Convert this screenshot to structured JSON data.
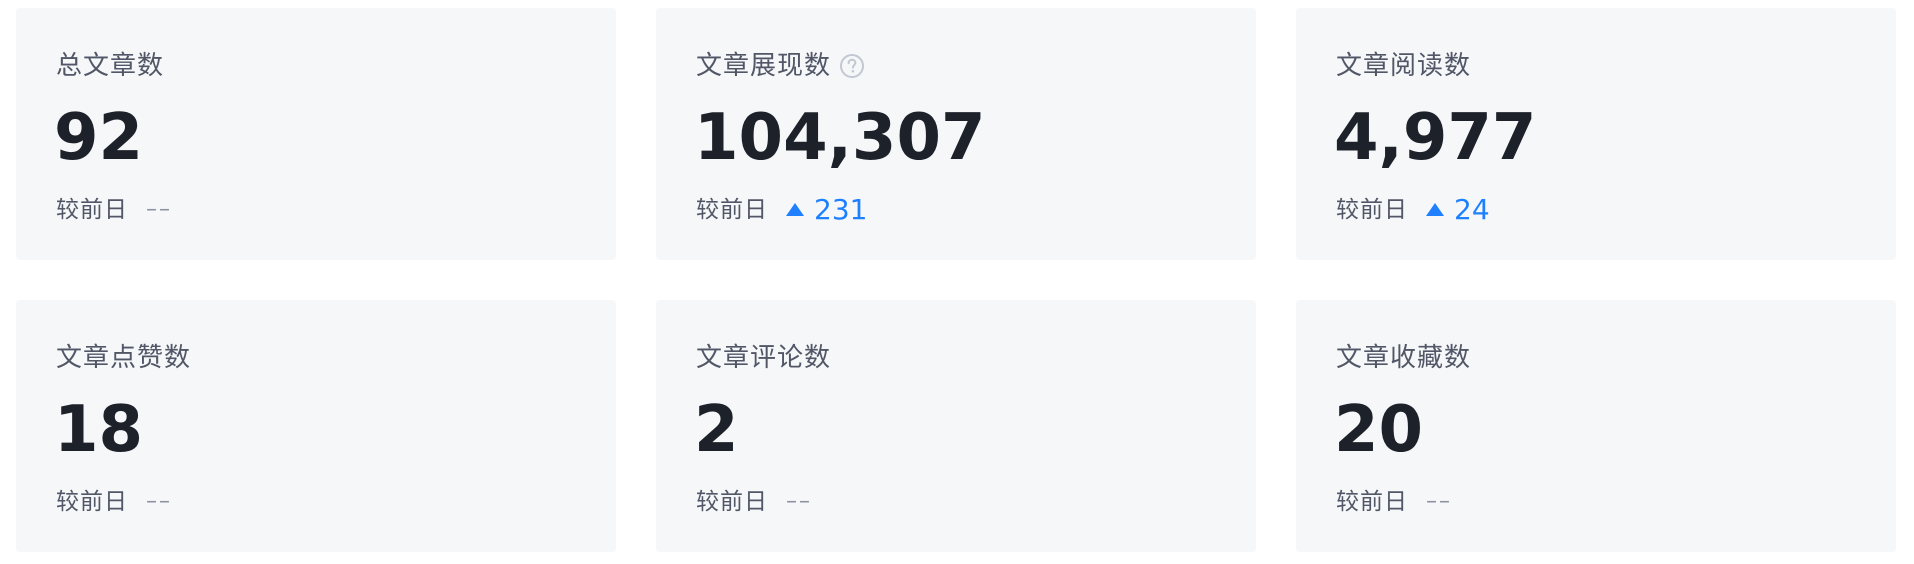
{
  "compare_label": "较前日",
  "empty_compare": "––",
  "colors": {
    "card_bg": "#f6f7f9",
    "label": "#515767",
    "value": "#1d2129",
    "accent_up": "#1e80ff",
    "muted": "#8a919f"
  },
  "stats": [
    {
      "label": "总文章数",
      "value": "92",
      "delta": null,
      "trend": "none"
    },
    {
      "label": "文章展现数",
      "value": "104,307",
      "delta": "231",
      "trend": "up",
      "help_icon": "question-circle-icon"
    },
    {
      "label": "文章阅读数",
      "value": "4,977",
      "delta": "24",
      "trend": "up"
    },
    {
      "label": "文章点赞数",
      "value": "18",
      "delta": null,
      "trend": "none"
    },
    {
      "label": "文章评论数",
      "value": "2",
      "delta": null,
      "trend": "none"
    },
    {
      "label": "文章收藏数",
      "value": "20",
      "delta": null,
      "trend": "none"
    }
  ]
}
